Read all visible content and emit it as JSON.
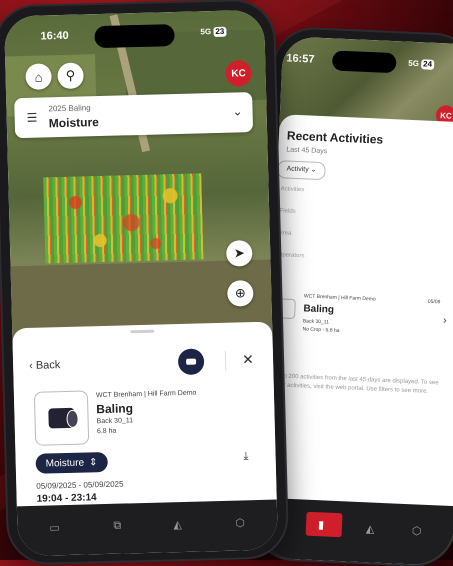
{
  "front": {
    "status": {
      "time": "16:40",
      "signal": "5G",
      "battery": "23"
    },
    "map": {
      "user_initials": "KC"
    },
    "layer": {
      "subtitle": "2025 Baling",
      "title": "Moisture"
    },
    "sheet": {
      "back_label": "Back",
      "activity": {
        "farm": "WCT Brenham | Hill Farm Demo",
        "name": "Baling",
        "field": "Back 30_11",
        "area": "6.8 ha"
      },
      "layer_pill": "Moisture",
      "dates": "05/09/2025 - 05/09/2025",
      "times": "19:04 - 23:14"
    }
  },
  "back": {
    "status": {
      "time": "16:57",
      "signal": "5G",
      "battery": "24"
    },
    "user_initials": "KC",
    "title": "Recent Activities",
    "subtitle": "Last 45 Days",
    "filter": "Activity",
    "faint_rows": [
      "Activities",
      "Fields",
      "Area",
      "Operators"
    ],
    "activity": {
      "farm": "WCT Brenham | Hill Farm Demo",
      "date": "05/09",
      "name": "Baling",
      "field": "Back 30_11",
      "area": "No Crop - 6.8 ha"
    },
    "note": "Up to 200 activities from the last 45 days are displayed. To see older activities, visit the web portal. Use filters to see more."
  },
  "colors": {
    "brand_red": "#d01f2b",
    "navy": "#1c2545"
  }
}
